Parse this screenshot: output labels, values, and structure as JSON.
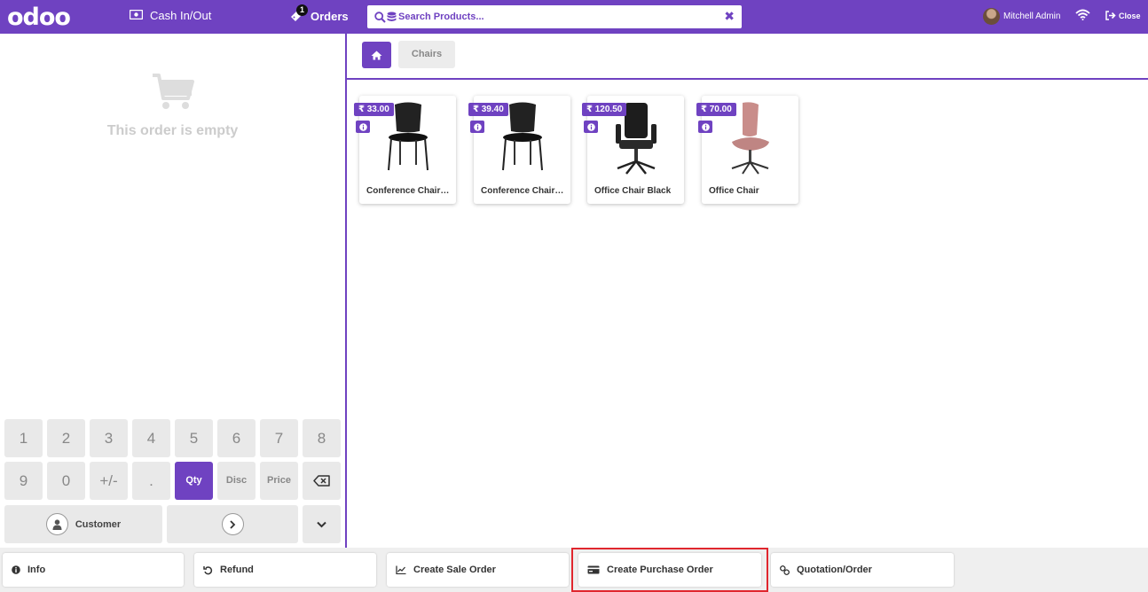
{
  "topbar": {
    "logo": "odoo",
    "cash_label": "Cash In/Out",
    "orders_label": "Orders",
    "orders_badge": "1",
    "search_placeholder": "Search Products...",
    "user_name": "Mitchell Admin",
    "close_label": "Close",
    "accent_color": "#6f42c1"
  },
  "order": {
    "empty_text": "This order is empty"
  },
  "numpad": {
    "row1": [
      "1",
      "2",
      "3",
      "4",
      "5",
      "6",
      "7",
      "8"
    ],
    "row2": [
      "9",
      "0",
      "+/-",
      ".",
      "Qty",
      "Disc",
      "Price"
    ],
    "customer_label": "Customer"
  },
  "categories": {
    "current": "Chairs"
  },
  "products": [
    {
      "name": "Conference Chair (Steel)",
      "price": "₹ 33.00"
    },
    {
      "name": "Conference Chair (Aluminium)",
      "price": "₹ 39.40"
    },
    {
      "name": "Office Chair Black",
      "price": "₹ 120.50"
    },
    {
      "name": "Office Chair",
      "price": "₹ 70.00"
    }
  ],
  "actions": [
    {
      "label": "Info",
      "icon": "info-icon"
    },
    {
      "label": "Refund",
      "icon": "undo-icon"
    },
    {
      "label": "Create Sale Order",
      "icon": "chart-icon"
    },
    {
      "label": "Create Purchase Order",
      "icon": "credit-card-icon"
    },
    {
      "label": "Quotation/Order",
      "icon": "link-icon"
    }
  ],
  "highlight_color": "#e0262e"
}
